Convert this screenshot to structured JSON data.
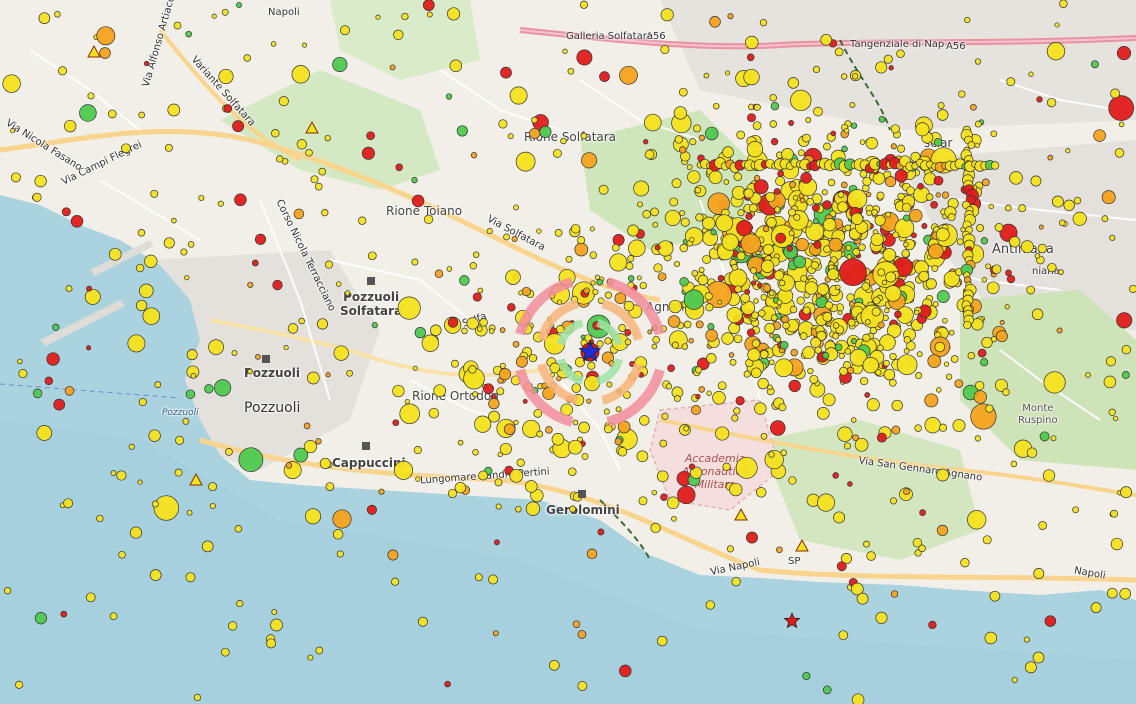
{
  "map": {
    "labels": {
      "pozzuoli": "Pozzuoli",
      "pozzuoli_small": "Pozzuoli",
      "pozzuoli_station": "Pozzuoli",
      "pozzuoli_solfatara_1": "Pozzuoli",
      "pozzuoli_solfatara_2": "Solfatara",
      "rione_ortodonico": "Rione Ortodon",
      "rione_toiano": "Rione Toiano",
      "rione_solfatara": "Rione Solfatara",
      "cappuccini": "Cappuccini",
      "gerolomini": "Gerolomini",
      "antiniana": "Antiniana",
      "monte_ruspino_1": "Monte",
      "monte_ruspino_2": "Ruspino",
      "accademia_1": "Accademia",
      "accademia_2": "Aeronautica",
      "accademia_3": "Militare",
      "via_campi_flegrei": "Via Campi Flegrei",
      "via_solfatara": "Via Solfatara",
      "variante_solfatara": "Variante Solfatara",
      "via_san_gennaro": "Via San Gennaro Agnano",
      "tangenziale": "Tangenziale di Nap",
      "a56_1": "A56",
      "a56_2": "A56",
      "galleria": "Galleria Solfatara",
      "via_nicola_fasano": "Via Nicola Fasano",
      "corso_terracciano": "Corso Nicola Terracciano",
      "lungomare": "Lungomare Sandro Pertini",
      "via_napoli": "Via Napoli",
      "sp": "SP",
      "via_napoli_top": "Napoli",
      "via_alfonso": "Via Alfonso Artiaco",
      "agnano": "Agnano",
      "sciara": "sciar",
      "antiniana_road": "niana",
      "via_napoli_right": "Napoli",
      "road_a": "Via Solfa"
    },
    "colors": {
      "sea": "#aad3df",
      "sea_deep": "#8cc4e6",
      "land": "#f2efe9",
      "park": "#d5e8c4",
      "residential": "#e0dfdf",
      "military": "#f5dede",
      "road_major": "#f8d48c",
      "road_minor": "#ffffff",
      "motorway": "#e892a2",
      "marker_yellow": "#f4e21c",
      "marker_orange": "#f5a21c",
      "marker_green": "#4ec94e",
      "marker_red": "#e21b1b",
      "epicenter": "#1a2fd6",
      "ring_pink": "#f28d9c",
      "ring_orange": "#f8b47a"
    },
    "icons": [
      "epicenter-star-icon",
      "station-triangle-icon",
      "red-star-icon",
      "poi-square-icon"
    ]
  }
}
